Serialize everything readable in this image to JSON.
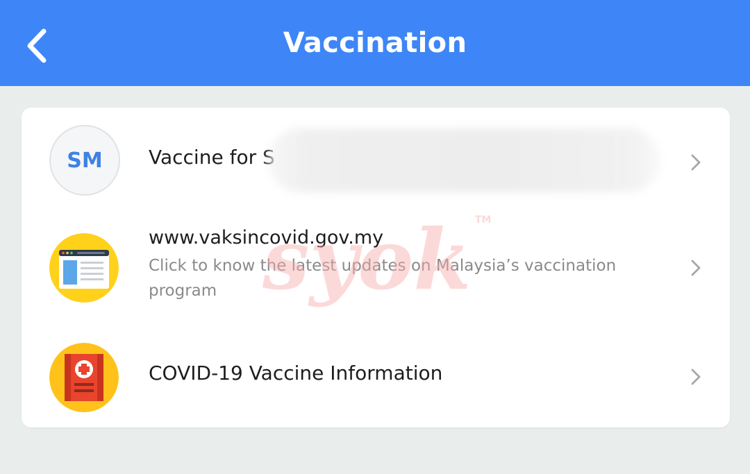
{
  "header": {
    "title": "Vaccination",
    "back_icon": "chevron-left-icon",
    "background_color": "#3e86f7"
  },
  "items": [
    {
      "avatar_text": "SM",
      "title": "Vaccine for S",
      "chevron_icon": "chevron-right-icon"
    },
    {
      "icon": "browser-window-icon",
      "title": "www.vaksincovid.gov.my",
      "subtitle": "Click to know the latest updates on Malaysia’s vaccination program",
      "chevron_icon": "chevron-right-icon"
    },
    {
      "icon": "medical-book-icon",
      "title": "COVID-19 Vaccine Information",
      "chevron_icon": "chevron-right-icon"
    }
  ],
  "watermark": {
    "text": "syok",
    "mark": "TM"
  }
}
